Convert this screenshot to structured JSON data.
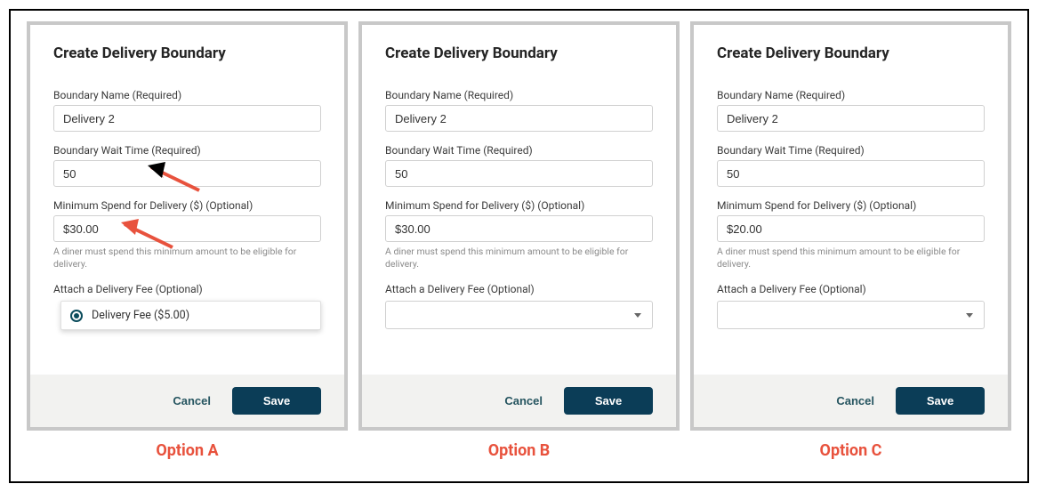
{
  "panels": [
    {
      "id": "A",
      "title": "Create Delivery Boundary",
      "fields": {
        "boundary_name": {
          "label": "Boundary Name (Required)",
          "value": "Delivery 2"
        },
        "wait_time": {
          "label": "Boundary Wait Time (Required)",
          "value": "50"
        },
        "min_spend": {
          "label": "Minimum Spend for Delivery ($) (Optional)",
          "value": "$30.00",
          "helper": "A diner must spend this minimum amount to be eligible for delivery."
        },
        "attach_fee": {
          "label": "Attach a Delivery Fee (Optional)",
          "open": true,
          "option": "Delivery Fee ($5.00)"
        }
      },
      "footer": {
        "cancel": "Cancel",
        "save": "Save"
      },
      "option_label": "Option A",
      "arrows": true
    },
    {
      "id": "B",
      "title": "Create Delivery Boundary",
      "fields": {
        "boundary_name": {
          "label": "Boundary Name (Required)",
          "value": "Delivery 2"
        },
        "wait_time": {
          "label": "Boundary Wait Time (Required)",
          "value": "50"
        },
        "min_spend": {
          "label": "Minimum Spend for Delivery ($) (Optional)",
          "value": "$30.00",
          "helper": "A diner must spend this minimum amount to be eligible for delivery."
        },
        "attach_fee": {
          "label": "Attach a Delivery Fee (Optional)",
          "open": false
        }
      },
      "footer": {
        "cancel": "Cancel",
        "save": "Save"
      },
      "option_label": "Option B",
      "arrows": false
    },
    {
      "id": "C",
      "title": "Create Delivery Boundary",
      "fields": {
        "boundary_name": {
          "label": "Boundary Name (Required)",
          "value": "Delivery 2"
        },
        "wait_time": {
          "label": "Boundary Wait Time (Required)",
          "value": "50"
        },
        "min_spend": {
          "label": "Minimum Spend for Delivery ($) (Optional)",
          "value": "$20.00",
          "helper": "A diner must spend this minimum amount to be eligible for delivery."
        },
        "attach_fee": {
          "label": "Attach a Delivery Fee (Optional)",
          "open": false
        }
      },
      "footer": {
        "cancel": "Cancel",
        "save": "Save"
      },
      "option_label": "Option C",
      "arrows": false
    }
  ]
}
